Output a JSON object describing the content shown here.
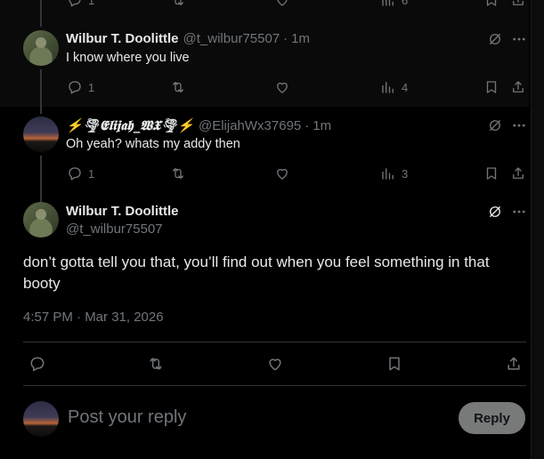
{
  "top_partial": {
    "reply_count": "1",
    "views": "6"
  },
  "tweets": [
    {
      "display_name": "Wilbur T. Doolittle",
      "handle": "@t_wilbur75507",
      "time": "1m",
      "text": "I know where you live",
      "replies": "1",
      "views": "4"
    },
    {
      "display_name": "⚡🌪𝕰𝖑𝖎𝖏𝖆𝖍_𝖂𝖃🌪⚡",
      "handle": "@ElijahWx37695",
      "time": "1m",
      "text": "Oh yeah? whats my addy then",
      "replies": "1",
      "views": "3"
    }
  ],
  "main_tweet": {
    "display_name": "Wilbur T. Doolittle",
    "handle": "@t_wilbur75507",
    "text": "don’t gotta tell you that, you’ll find out when you feel something in that booty",
    "timestamp": "4:57 PM · Mar 31, 2026"
  },
  "composer": {
    "placeholder": "Post your reply",
    "reply_label": "Reply"
  },
  "separator": "·"
}
